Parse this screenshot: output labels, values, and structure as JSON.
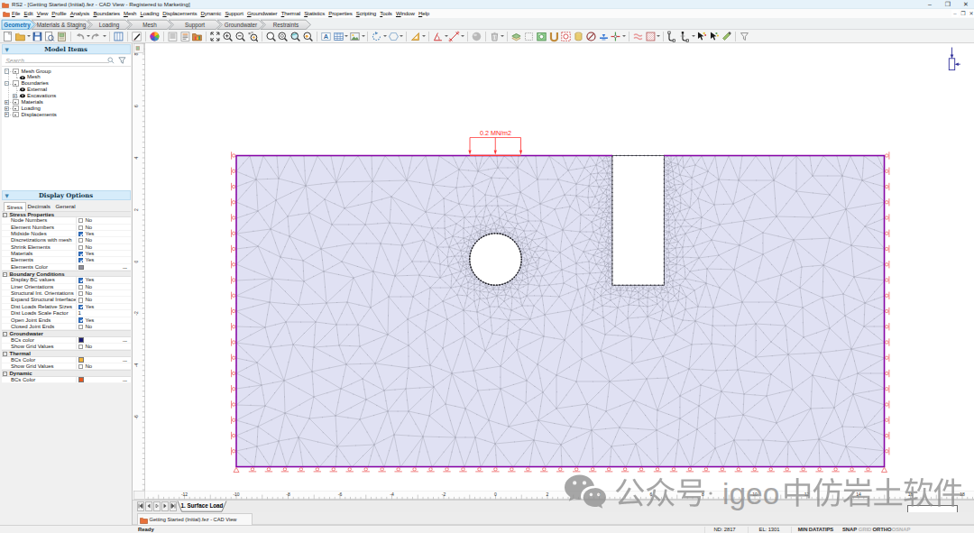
{
  "window": {
    "title": "RS2 - [Getting Started (Initial).fez - CAD View - Registered to Marketing]",
    "controls": {
      "minimize": "–",
      "restore": "❐",
      "close": "✕"
    }
  },
  "menu": {
    "items": [
      {
        "label": "File",
        "m": 0
      },
      {
        "label": "Edit",
        "m": 0
      },
      {
        "label": "View",
        "m": 0
      },
      {
        "label": "Profile",
        "m": 0
      },
      {
        "label": "Analysis",
        "m": 0
      },
      {
        "label": "Boundaries",
        "m": 0
      },
      {
        "label": "Mesh",
        "m": 0
      },
      {
        "label": "Loading",
        "m": 0
      },
      {
        "label": "Displacements",
        "m": 0
      },
      {
        "label": "Dynamic",
        "m": 0
      },
      {
        "label": "Support",
        "m": 0
      },
      {
        "label": "Groundwater",
        "m": 0
      },
      {
        "label": "Thermal",
        "m": 0
      },
      {
        "label": "Statistics",
        "m": 0
      },
      {
        "label": "Properties",
        "m": 0
      },
      {
        "label": "Scripting",
        "m": 0
      },
      {
        "label": "Tools",
        "m": 0
      },
      {
        "label": "Window",
        "m": 0
      },
      {
        "label": "Help",
        "m": 0
      }
    ],
    "mdi_controls": {
      "minimize": "–",
      "restore": "❐",
      "close": "✕"
    }
  },
  "workflow": {
    "tabs": [
      {
        "label": "Geometry",
        "active": true
      },
      {
        "label": "Materials & Staging",
        "active": false
      },
      {
        "label": "Loading",
        "active": false
      },
      {
        "label": "Mesh",
        "active": false
      },
      {
        "label": "Support",
        "active": false
      },
      {
        "label": "Groundwater",
        "active": false
      },
      {
        "label": "Restraints",
        "active": false
      }
    ]
  },
  "toolbar": {
    "buttons": [
      {
        "name": "new-file",
        "icon": "new"
      },
      {
        "name": "open-file",
        "icon": "open",
        "dd": true
      },
      {
        "name": "save",
        "icon": "save"
      },
      {
        "name": "print-preview",
        "icon": "preview"
      },
      {
        "name": "project-settings",
        "icon": "package"
      },
      {
        "sep": true
      },
      {
        "name": "undo",
        "icon": "undo",
        "dd": true
      },
      {
        "name": "redo",
        "icon": "redo",
        "dd": true
      },
      {
        "sep": true
      },
      {
        "name": "view-columns",
        "icon": "columns"
      },
      {
        "sep": true
      },
      {
        "name": "pen-sketch",
        "icon": "pen"
      },
      {
        "sep": true
      },
      {
        "name": "color-wheel",
        "icon": "wheel"
      },
      {
        "sep": true
      },
      {
        "name": "list-view",
        "icon": "list"
      },
      {
        "name": "report-view",
        "icon": "report"
      },
      {
        "name": "folder-chart",
        "icon": "folderchart"
      },
      {
        "sep": true
      },
      {
        "name": "zoom-all",
        "icon": "fitall"
      },
      {
        "name": "zoom-in",
        "icon": "zoomin"
      },
      {
        "name": "zoom-out",
        "icon": "zoomout"
      },
      {
        "name": "zoom-points",
        "icon": "zoomsel"
      },
      {
        "sep": true
      },
      {
        "name": "zoom-window",
        "icon": "mag"
      },
      {
        "name": "zoom-extents",
        "icon": "mago"
      },
      {
        "name": "zoom-previous",
        "icon": "magc"
      },
      {
        "name": "zoom-objects",
        "icon": "magy"
      },
      {
        "sep": true
      },
      {
        "name": "text-label",
        "icon": "abox"
      },
      {
        "name": "grid-table",
        "icon": "table",
        "dd": true
      },
      {
        "name": "insert-image",
        "icon": "image",
        "dd": true
      },
      {
        "sep": true
      },
      {
        "name": "rotate-selection",
        "icon": "rotate",
        "dd": true
      },
      {
        "name": "polygon-tool",
        "icon": "polygon",
        "dd": true
      },
      {
        "sep": true
      },
      {
        "name": "set-square",
        "icon": "setsquare",
        "dd": true
      },
      {
        "sep": true
      },
      {
        "name": "protractor",
        "icon": "protractor",
        "dd": true
      },
      {
        "name": "dimension",
        "icon": "dimension",
        "dd": true
      },
      {
        "sep": true
      },
      {
        "name": "sphere",
        "icon": "sphere"
      },
      {
        "sep": true
      },
      {
        "name": "delete",
        "icon": "trash",
        "dd": true
      },
      {
        "sep": true
      },
      {
        "name": "material-layers",
        "icon": "layers"
      },
      {
        "name": "copy-object",
        "icon": "copybox"
      },
      {
        "name": "snapshot",
        "icon": "snapshot"
      },
      {
        "name": "excavate",
        "icon": "excavate"
      },
      {
        "name": "mesh-region",
        "icon": "meshregion"
      },
      {
        "name": "borehole",
        "icon": "borehole"
      },
      {
        "name": "no-symbol",
        "icon": "nosym"
      },
      {
        "name": "water-table",
        "icon": "water"
      },
      {
        "name": "section-cut",
        "icon": "section",
        "dd": true
      },
      {
        "sep": true
      },
      {
        "name": "joint-boundary",
        "icon": "joints"
      },
      {
        "name": "hatch-region",
        "icon": "hatch",
        "dd": true
      },
      {
        "sep": true
      },
      {
        "name": "node-tool-1",
        "icon": "nodeb"
      },
      {
        "name": "node-tool-2",
        "icon": "nodeb2",
        "dd": true
      },
      {
        "name": "select-spark",
        "icon": "selspark"
      },
      {
        "name": "select-points",
        "icon": "seldots"
      },
      {
        "name": "select-pencil",
        "icon": "selpencil"
      },
      {
        "sep": true
      },
      {
        "name": "selection-filter",
        "icon": "funnel"
      }
    ]
  },
  "model_items": {
    "caption": "Model Items",
    "search_placeholder": "Search...",
    "tree": [
      {
        "label": "Mesh Group",
        "indent": 0,
        "expander": "-",
        "dropdown": true,
        "eye": false
      },
      {
        "label": "Mesh",
        "indent": 1,
        "expander": null,
        "dropdown": false,
        "eye": true
      },
      {
        "label": "Boundaries",
        "indent": 0,
        "expander": "-",
        "dropdown": true,
        "eye": false
      },
      {
        "label": "External",
        "indent": 1,
        "expander": null,
        "dropdown": false,
        "eye": true
      },
      {
        "label": "Excavations",
        "indent": 1,
        "expander": "+",
        "dropdown": false,
        "eye": true
      },
      {
        "label": "Materials",
        "indent": 0,
        "expander": "+",
        "dropdown": true,
        "eye": false
      },
      {
        "label": "Loading",
        "indent": 0,
        "expander": "+",
        "dropdown": true,
        "eye": false
      },
      {
        "label": "Displacements",
        "indent": 0,
        "expander": "+",
        "dropdown": true,
        "eye": false
      }
    ]
  },
  "display_options": {
    "caption": "Display Options",
    "tabs": [
      "Stress",
      "Decimals",
      "General"
    ],
    "active_tab": "Stress",
    "rows": [
      {
        "type": "group",
        "label": "Stress Properties"
      },
      {
        "type": "check",
        "label": "Node Numbers",
        "value": "No",
        "checked": false
      },
      {
        "type": "check",
        "label": "Element Numbers",
        "value": "No",
        "checked": false
      },
      {
        "type": "check",
        "label": "Midside Nodes",
        "value": "Yes",
        "checked": true
      },
      {
        "type": "check",
        "label": "Discretizations with mesh",
        "value": "No",
        "checked": false
      },
      {
        "type": "check",
        "label": "Shrink Elements",
        "value": "No",
        "checked": false
      },
      {
        "type": "check",
        "label": "Materials",
        "value": "Yes",
        "checked": true
      },
      {
        "type": "check",
        "label": "Elements",
        "value": "Yes",
        "checked": true
      },
      {
        "type": "color",
        "label": "Elements Color",
        "color": "#8e8e9d",
        "more": "..."
      },
      {
        "type": "group",
        "label": "Boundary Conditions"
      },
      {
        "type": "check",
        "label": "Display BC values",
        "value": "Yes",
        "checked": true
      },
      {
        "type": "check",
        "label": "Liner Orientations",
        "value": "No",
        "checked": false
      },
      {
        "type": "check",
        "label": "Structural Int. Orientations",
        "value": "No",
        "checked": false
      },
      {
        "type": "check",
        "label": "Expand Structural Interface",
        "value": "No",
        "checked": false
      },
      {
        "type": "check",
        "label": "Dist Loads Relative Sizes",
        "value": "Yes",
        "checked": true
      },
      {
        "type": "text",
        "label": "Dist Loads Scale Factor",
        "value": "1"
      },
      {
        "type": "check",
        "label": "Open Joint Ends",
        "value": "Yes",
        "checked": true
      },
      {
        "type": "check",
        "label": "Closed Joint Ends",
        "value": "No",
        "checked": false
      },
      {
        "type": "group",
        "label": "Groundwater"
      },
      {
        "type": "color",
        "label": "BCs color",
        "color": "#181872",
        "more": "..."
      },
      {
        "type": "check",
        "label": "Show Grid Values",
        "value": "No",
        "checked": false
      },
      {
        "type": "group",
        "label": "Thermal"
      },
      {
        "type": "color",
        "label": "BCs Color",
        "color": "#f2b238",
        "more": "..."
      },
      {
        "type": "check",
        "label": "Show Grid Values",
        "value": "No",
        "checked": false
      },
      {
        "type": "group",
        "label": "Dynamic"
      },
      {
        "type": "color",
        "label": "BCs Color",
        "color": "#e6571e",
        "more": "..."
      }
    ]
  },
  "canvas": {
    "load_label": "0.2 MN/m2",
    "h_ruler_labels": [
      "-12",
      "-10",
      "-8",
      "-6",
      "-4",
      "-2",
      "0",
      "2",
      "4",
      "6",
      "8",
      "10",
      "12",
      "14",
      "16",
      "18"
    ],
    "v_ruler_labels": [
      "8",
      "6",
      "4",
      "2",
      "0",
      "-2",
      "-4",
      "-6"
    ],
    "node_count_note": ""
  },
  "sheet_tabs": {
    "active": "1. Surface Load"
  },
  "mdi_tab": {
    "label": "Getting Started (Initial).fez - CAD View"
  },
  "status": {
    "left": "Ready",
    "nd": "ND: 2817",
    "el": "EL: 1301",
    "min_datatips": "MIN DATATIPS",
    "snap": "SNAP",
    "grid": "GRID",
    "ortho": "ORTHO",
    "osnap": "OSNAP"
  },
  "watermark": {
    "cn_prefix": "公众号",
    "dot": "·",
    "latin": "igeo",
    "cn_suffix": "中仿岩土软件"
  }
}
